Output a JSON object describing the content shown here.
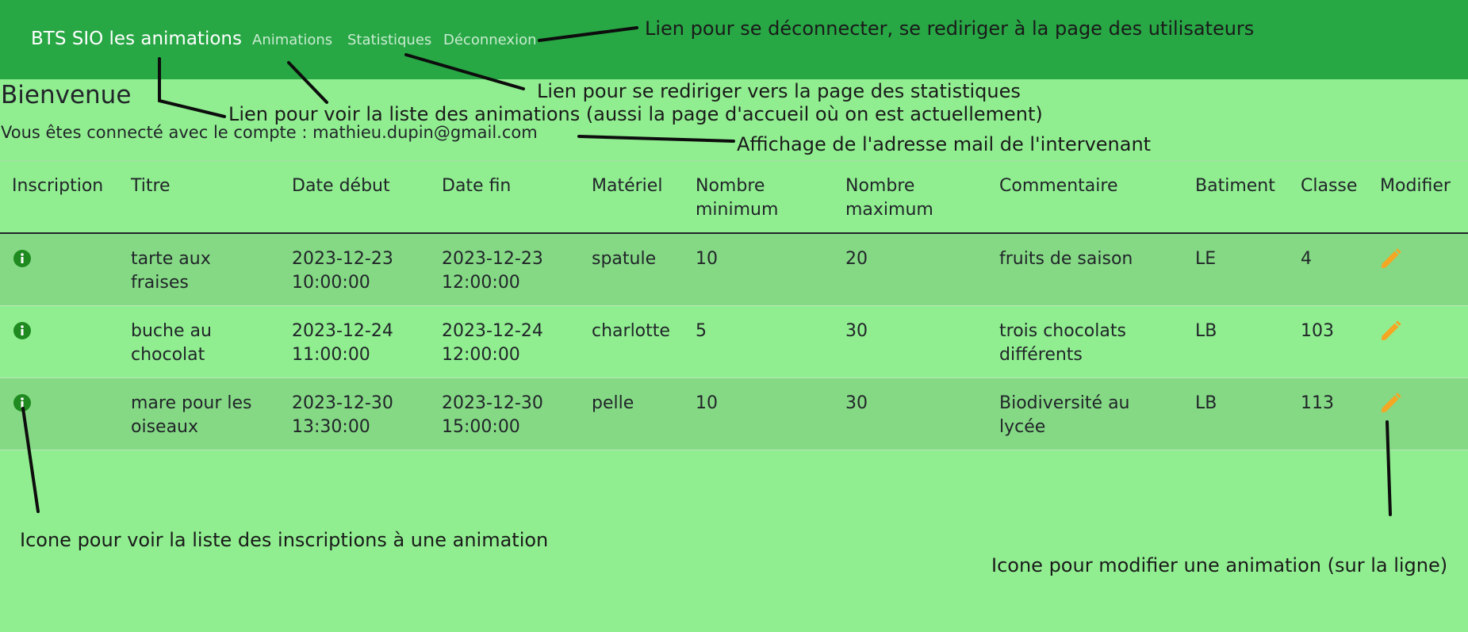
{
  "navbar": {
    "brand": "BTS SIO les animations",
    "links": [
      "Animations",
      "Statistiques",
      "Déconnexion"
    ]
  },
  "welcome": {
    "title": "Bienvenue",
    "account_prefix": "Vous êtes connecté avec le compte : mathieu.dupin@gmail.com"
  },
  "table": {
    "headers": [
      "Inscription",
      "Titre",
      "Date début",
      "Date fin",
      "Matériel",
      "Nombre minimum",
      "Nombre maximum",
      "Commentaire",
      "Batiment",
      "Classe",
      "Modifier"
    ],
    "rows": [
      {
        "titre": "tarte aux fraises",
        "date_debut": "2023-12-23 10:00:00",
        "date_fin": "2023-12-23 12:00:00",
        "materiel": "spatule",
        "nb_min": "10",
        "nb_max": "20",
        "commentaire": "fruits de saison",
        "batiment": "LE",
        "classe": "4"
      },
      {
        "titre": "buche au chocolat",
        "date_debut": "2023-12-24 11:00:00",
        "date_fin": "2023-12-24 12:00:00",
        "materiel": "charlotte",
        "nb_min": "5",
        "nb_max": "30",
        "commentaire": "trois chocolats différents",
        "batiment": "LB",
        "classe": "103"
      },
      {
        "titre": "mare pour les oiseaux",
        "date_debut": "2023-12-30 13:30:00",
        "date_fin": "2023-12-30 15:00:00",
        "materiel": "pelle",
        "nb_min": "10",
        "nb_max": "30",
        "commentaire": "Biodiversité au lycée",
        "batiment": "LB",
        "classe": "113"
      }
    ]
  },
  "annotations": {
    "logout": "Lien pour se déconnecter, se rediriger à la page des utilisateurs",
    "stats": "Lien pour se rediriger vers la page des statistiques",
    "animations": "Lien pour voir la liste des animations (aussi la page d'accueil où on est actuellement)",
    "email": "Affichage de l'adresse mail de l'intervenant",
    "inscriptions": "Icone pour voir la liste des inscriptions à une animation",
    "edit": "Icone pour modifier une animation (sur la ligne)"
  },
  "icons": {
    "info": "info-circle-icon",
    "edit": "pencil-icon"
  },
  "colors": {
    "navbar": "#28a745",
    "background": "#90ee90",
    "row_striped": "#85d985",
    "info_icon": "#1f8a1f",
    "edit_icon": "#f5a623"
  }
}
